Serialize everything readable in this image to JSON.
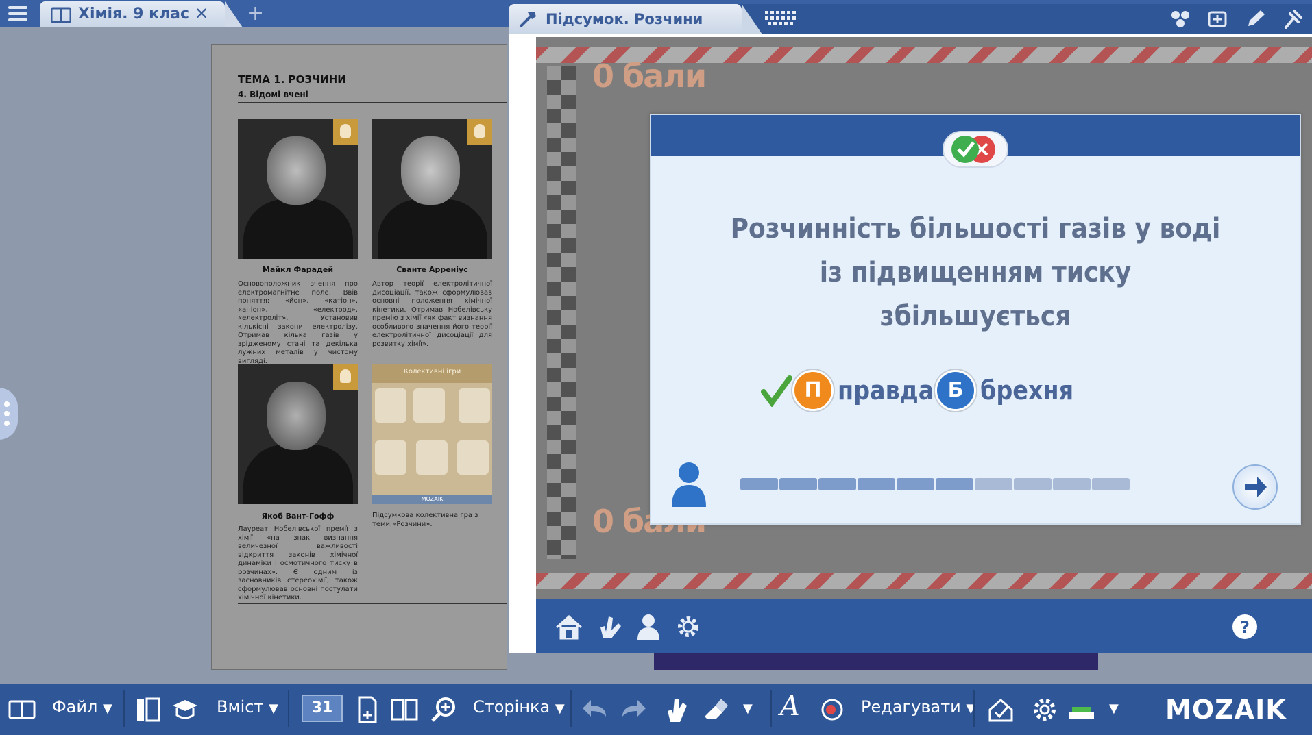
{
  "topbar": {
    "tab_title": "Хімія. 9 клас",
    "close_glyph": "✕",
    "new_tab_glyph": "+"
  },
  "book": {
    "topic": "ТЕМА 1. РОЗЧИНИ",
    "subtopic": "4. Відомі вчені",
    "people": [
      {
        "name": "Майкл Фарадей",
        "desc": "Основоположник вчення про електромагнітне поле. Ввів поняття: «йон», «катіон», «аніон», «електрод», «електроліт». Установив кількісні закони електролізу. Отримав кілька газів у зрідженому стані та декілька лужних металів у чистому вигляді."
      },
      {
        "name": "Сванте Арреніус",
        "desc": "Автор теорії електролітичної дисоціації, також сформулював основні положення хімічної кінетики. Отримав Нобелівську премію з хімії «як факт визнання особливого значення його теорії електролітичної дисоціації для розвитку хімії»."
      },
      {
        "name": "Якоб Вант-Гофф",
        "desc": "Лауреат Нобелівської премії з хімії «на знак визнання величезної важливості відкриття законів хімічної динаміки і осмотичного тиску в розчинах». Є одним із засновників стереохімії, також сформулював основні постулати хімічної кінетики."
      }
    ],
    "game_card": {
      "header": "Колективні ігри",
      "footer": "MOZAIK",
      "caption": "Підсумкова колективна гра з теми «Розчини»."
    }
  },
  "game_window": {
    "title": "Підсумок. Розчини",
    "score_top": "0 бали",
    "score_bottom": "0 бали"
  },
  "question": {
    "text": "Розчинність більшості газів у воді із підвищенням тиску збільшується",
    "answers": [
      {
        "key": "П",
        "label": "правда",
        "color": "#f08a1c",
        "selected": true
      },
      {
        "key": "Б",
        "label": "брехня",
        "color": "#2e73c8",
        "selected": false
      }
    ],
    "progress": {
      "total": 10,
      "done": 6
    },
    "colors": {
      "done": "#7e9ccb",
      "todo": "#a8bad6"
    }
  },
  "bottombar": {
    "file": "Файл",
    "contents": "Вміст",
    "page_number": "31",
    "page": "Сторінка",
    "edit": "Редагувати",
    "logo": "MOZAIK",
    "dropdown_glyph": "▼"
  }
}
